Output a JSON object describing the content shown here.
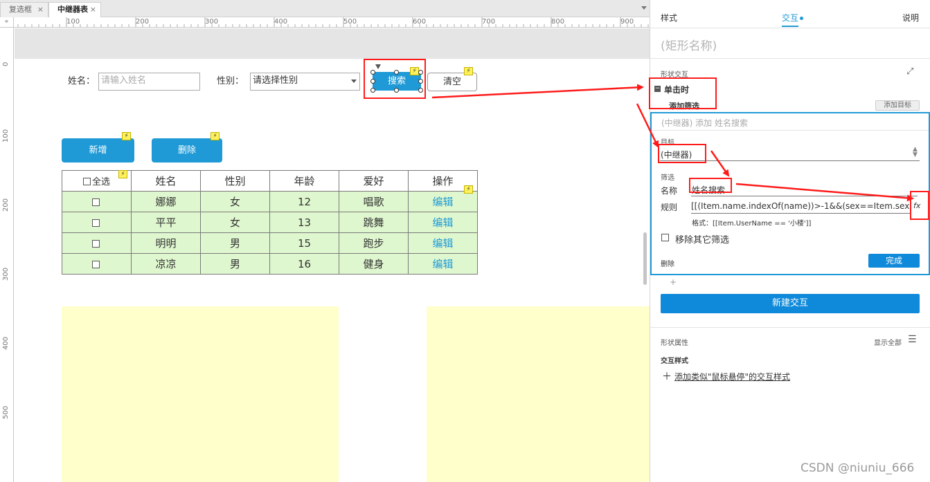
{
  "tabs": [
    {
      "label": "复选框",
      "close": "×"
    },
    {
      "label": "中继器表",
      "close": "×"
    }
  ],
  "ruler": {
    "h": [
      "100",
      "200",
      "300",
      "400",
      "500",
      "600",
      "700",
      "800",
      "900"
    ],
    "v": [
      "0",
      "100",
      "200",
      "300",
      "400",
      "500"
    ]
  },
  "form": {
    "name_label": "姓名：",
    "name_placeholder": "请输入姓名",
    "gender_label": "性别：",
    "gender_value": "请选择性别",
    "search_button": "搜索",
    "clear_button": "清空",
    "add_button": "新增",
    "delete_button": "删除"
  },
  "table": {
    "headers": [
      "全选",
      "姓名",
      "性别",
      "年龄",
      "爱好",
      "操作"
    ],
    "rows": [
      {
        "name": "娜娜",
        "gender": "女",
        "age": "12",
        "hobby": "唱歌",
        "action": "编辑"
      },
      {
        "name": "平平",
        "gender": "女",
        "age": "13",
        "hobby": "跳舞",
        "action": "编辑"
      },
      {
        "name": "明明",
        "gender": "男",
        "age": "15",
        "hobby": "跑步",
        "action": "编辑"
      },
      {
        "name": "凉凉",
        "gender": "男",
        "age": "16",
        "hobby": "健身",
        "action": "编辑"
      }
    ]
  },
  "panel": {
    "tabs": [
      "样式",
      "交互",
      "说明"
    ],
    "shape_name": "(矩形名称)",
    "shape_interaction": "形状交互",
    "event": "单击时",
    "add_filter": "添加筛选",
    "add_target": "添加目标",
    "card_title": "(中继器) 添加 姓名搜索",
    "target_label": "目标",
    "target_value": "(中继器)",
    "filter_label": "筛选",
    "name_label": "名称",
    "name_value": "姓名搜索",
    "rule_label": "规则",
    "rule_value": "[[(Item.name.indexOf(name))>-1&&(sex==Item.sex",
    "fx": "fx",
    "format_hint": "格式：[[Item.UserName == '小楼']]",
    "remove_other": "移除其它筛选",
    "delete": "删除",
    "done": "完成",
    "plus": "+",
    "new_interaction": "新建交互",
    "shape_props": "形状属性",
    "show_all": "显示全部",
    "interaction_style": "交互样式",
    "add_style": "添加类似\"鼠标悬停\"的交互样式"
  },
  "watermark": "CSDN @niuniu_666",
  "colors": {
    "accent": "#1f9ad6",
    "annotation": "#ff1a1a",
    "row_bg": "#dff7cf",
    "sticky_bg": "#ffffcc"
  }
}
